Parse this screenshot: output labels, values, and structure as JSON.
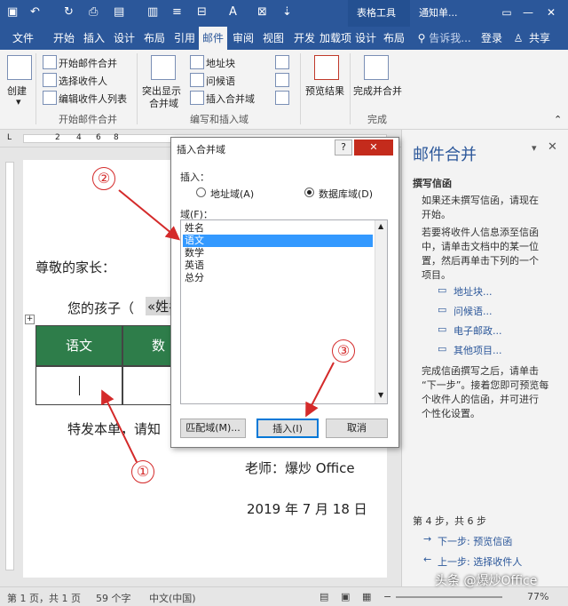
{
  "titlebar": {
    "context_tab": "表格工具",
    "doc_title": "通知单...",
    "colors": {
      "brand": "#2b579a"
    }
  },
  "tabs": [
    {
      "label": "文件"
    },
    {
      "label": "开始"
    },
    {
      "label": "插入"
    },
    {
      "label": "设计"
    },
    {
      "label": "布局"
    },
    {
      "label": "引用"
    },
    {
      "label": "邮件"
    },
    {
      "label": "审阅"
    },
    {
      "label": "视图"
    },
    {
      "label": "开发工"
    },
    {
      "label": "加载项"
    },
    {
      "label": "设计"
    },
    {
      "label": "布局"
    }
  ],
  "tell_me": "告诉我...",
  "signin": "登录",
  "share": "共享",
  "ribbon": {
    "create": "创建",
    "start_merge": "开始邮件合并",
    "select_recipients": "选择收件人",
    "edit_list": "编辑收件人列表",
    "group_start": "开始邮件合并",
    "highlight": "突出显示",
    "merge_fields": "合并域",
    "address_block": "地址块",
    "greeting_line": "问候语",
    "insert_merge_field": "插入合并域",
    "group_write": "编写和插入域",
    "preview_results": "预览结果",
    "finish_merge": "完成并合并",
    "group_finish": "完成"
  },
  "ruler": {
    "marks": [
      "2",
      "4",
      "6",
      "8"
    ]
  },
  "document": {
    "greeting": "尊敬的家长：",
    "child_line_start": "您的孩子（",
    "child_field": "«姓名",
    "table_header_1": "语文",
    "table_header_2": "数",
    "send_line": "特发本单，请知",
    "teacher": "老师：爆炒 Office",
    "date": "2019 年 7 月 18 日"
  },
  "dialog": {
    "title": "插入合并域",
    "help": "?",
    "insert_label": "插入：",
    "radio_address": "地址域(A)",
    "radio_database": "数据库域(D)",
    "field_label": "域(F)：",
    "fields": [
      "姓名",
      "语文",
      "数学",
      "英语",
      "总分"
    ],
    "selected_field": "语文",
    "btn_match": "匹配域(M)...",
    "btn_insert": "插入(I)",
    "btn_cancel": "取消"
  },
  "pane": {
    "title": "邮件合并",
    "subtitle": "撰写信函",
    "p1_line1": "如果还未撰写信函，请现在",
    "p1_line2": "开始。",
    "p2_line1": "若要将收件人信息添至信函",
    "p2_line2": "中，请单击文档中的某一位",
    "p2_line3": "置，然后再单击下列的一个",
    "p2_line4": "项目。",
    "links": [
      "地址块...",
      "问候语...",
      "电子邮政...",
      "其他项目..."
    ],
    "p3_line1": "完成信函撰写之后，请单击",
    "p3_line2": "“下一步”。接着您即可预览每",
    "p3_line3": "个收件人的信函，并可进行",
    "p3_line4": "个性化设置。",
    "step": "第 4 步，共 6 步",
    "next": "下一步: 预览信函",
    "prev": "上一步: 选择收件人"
  },
  "annotations": [
    "②",
    "③",
    "①"
  ],
  "status": {
    "page": "第 1 页，共 1 页",
    "words": "59 个字",
    "lang": "中文(中国)",
    "zoom": "77%",
    "watermark": "头条 @爆炒Office"
  }
}
